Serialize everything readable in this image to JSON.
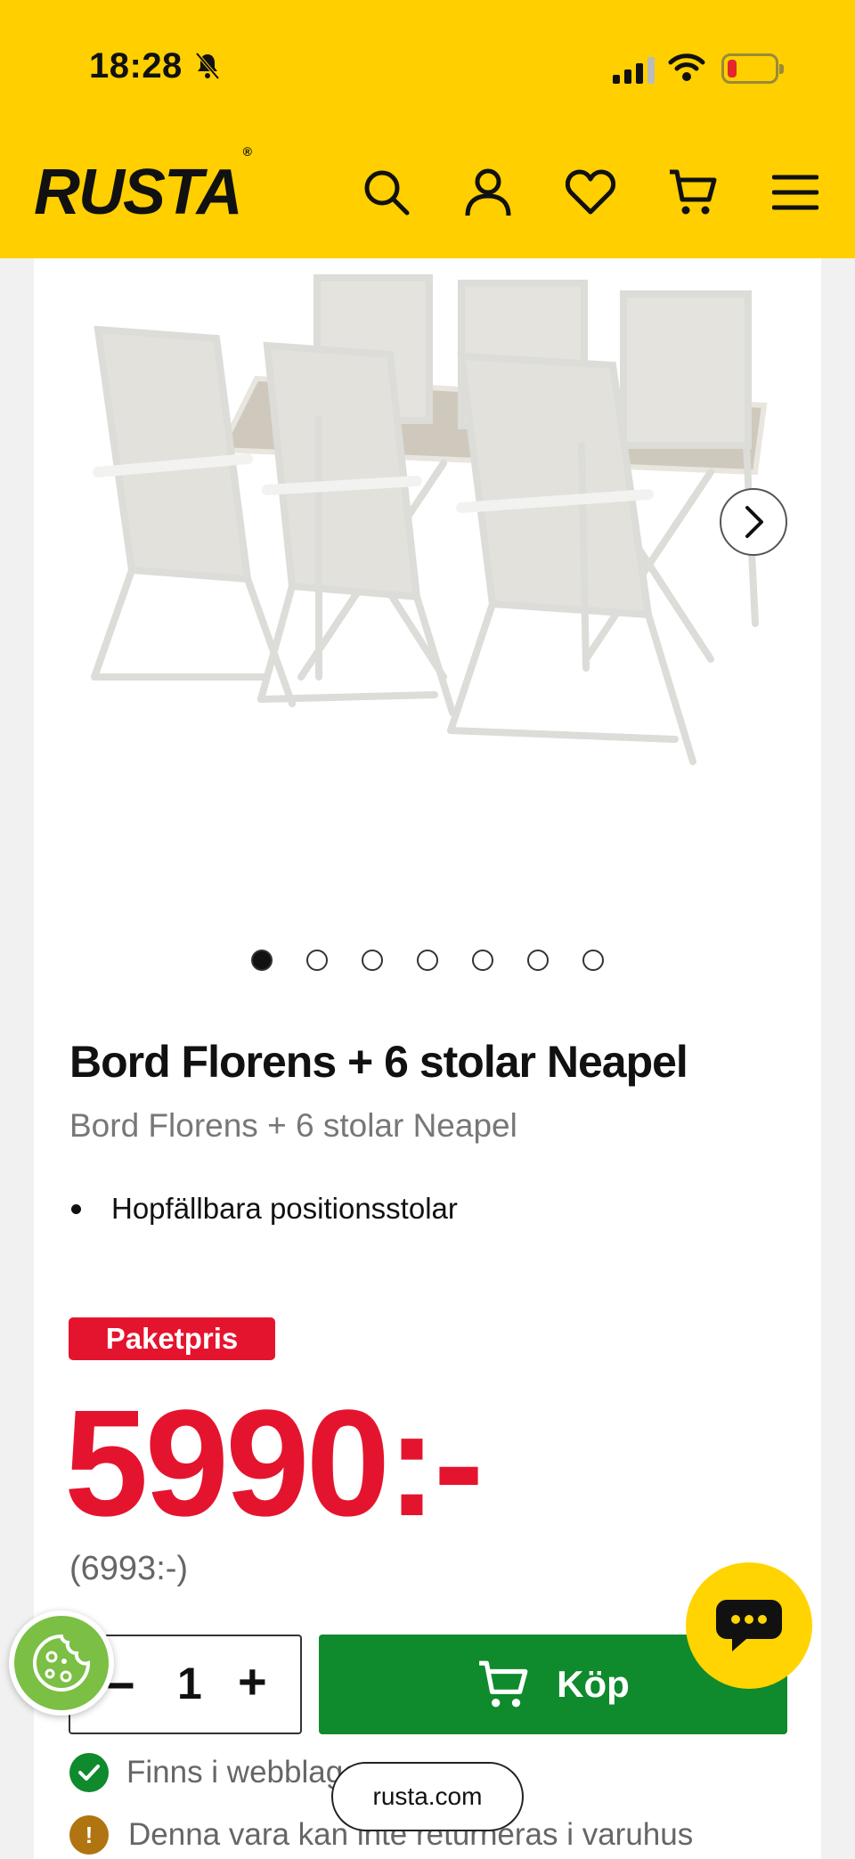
{
  "status_bar": {
    "time": "18:28"
  },
  "header": {
    "logo": "RUSTA",
    "icons": [
      "search-icon",
      "account-icon",
      "heart-icon",
      "cart-icon",
      "menu-icon"
    ]
  },
  "gallery": {
    "image_count": 7,
    "active_index": 0
  },
  "product": {
    "title": "Bord Florens + 6 stolar Neapel",
    "subtitle": "Bord Florens + 6 stolar Neapel",
    "features": [
      "Hopfällbara positionsstolar"
    ],
    "badge": "Paketpris",
    "price": "5990:-",
    "ordinary_price": "(6993:-)"
  },
  "purchase": {
    "minus": "−",
    "quantity": "1",
    "plus": "+",
    "buy_label": "Köp"
  },
  "availability": {
    "stock_text": "Finns i webblager",
    "return_text": "Denna vara kan inte returneras i varuhus"
  },
  "browser": {
    "url": "rusta.com"
  },
  "colors": {
    "brand_yellow": "#ffcf00",
    "price_red": "#e5142e",
    "buy_green": "#0f8a2d",
    "cookie_green": "#7bbf45"
  }
}
